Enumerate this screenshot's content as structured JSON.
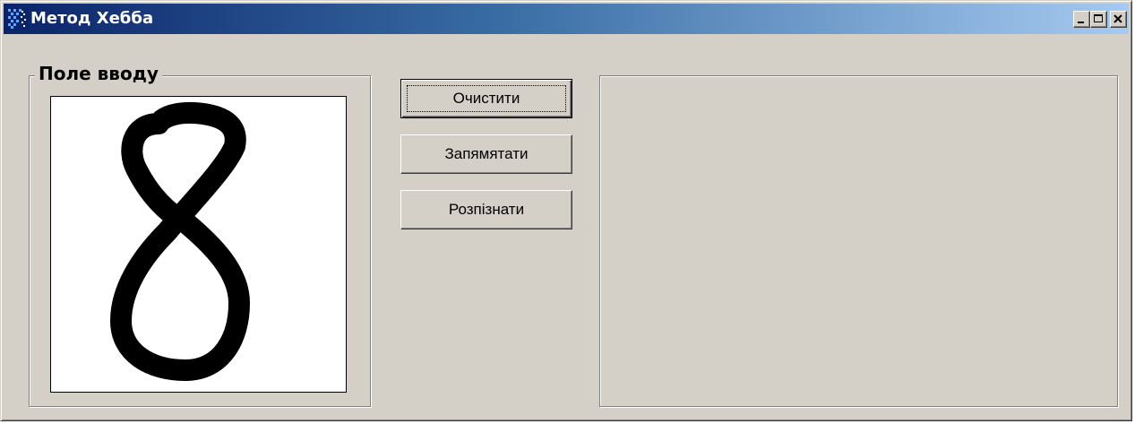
{
  "window": {
    "title": "Метод Хебба",
    "icon": "app-grid-icon",
    "controls": [
      "minimize-icon",
      "maximize-icon",
      "close-icon"
    ],
    "title_gradient": [
      "#0a246a",
      "#a6caf0"
    ],
    "face_color": "#d4d0c8"
  },
  "input_group": {
    "label": "Поле вводу",
    "drawn_symbol": "8"
  },
  "buttons": {
    "clear": "Очистити",
    "remember": "Запямятати",
    "recognize": "Розпізнати"
  },
  "result_panel": {
    "content": ""
  }
}
